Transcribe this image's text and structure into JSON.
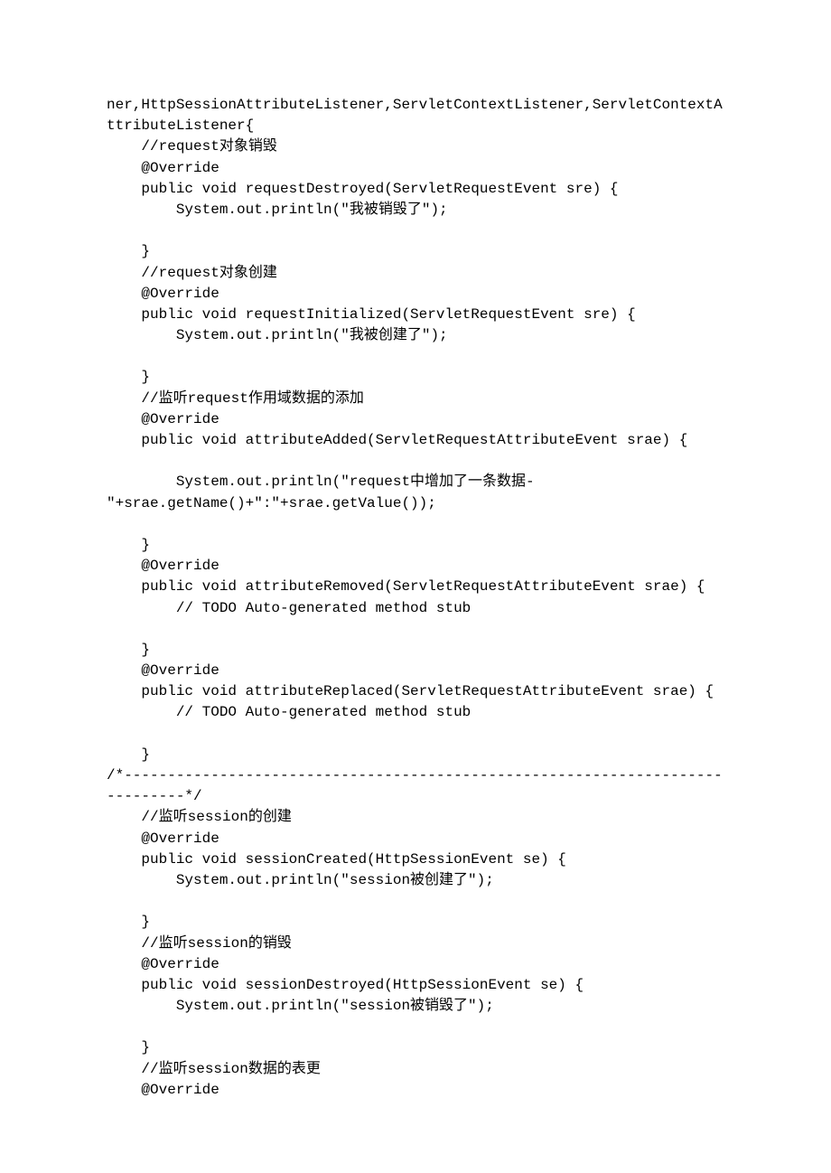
{
  "code": {
    "lines": [
      "ner,HttpSessionAttributeListener,ServletContextListener,ServletContextAttributeListener{",
      "    //request对象销毁",
      "    @Override",
      "    public void requestDestroyed(ServletRequestEvent sre) {",
      "        System.out.println(\"我被销毁了\");",
      "",
      "    }",
      "    //request对象创建",
      "    @Override",
      "    public void requestInitialized(ServletRequestEvent sre) {",
      "        System.out.println(\"我被创建了\");",
      "",
      "    }",
      "    //监听request作用域数据的添加",
      "    @Override",
      "    public void attributeAdded(ServletRequestAttributeEvent srae) {",
      "",
      "        System.out.println(\"request中增加了一条数据-\"+srae.getName()+\":\"+srae.getValue());",
      "",
      "    }",
      "    @Override",
      "    public void attributeRemoved(ServletRequestAttributeEvent srae) {",
      "        // TODO Auto-generated method stub",
      "",
      "    }",
      "    @Override",
      "    public void attributeReplaced(ServletRequestAttributeEvent srae) {",
      "        // TODO Auto-generated method stub",
      "",
      "    }",
      "/*------------------------------------------------------------------------------*/",
      "    //监听session的创建",
      "    @Override",
      "    public void sessionCreated(HttpSessionEvent se) {",
      "        System.out.println(\"session被创建了\");",
      "",
      "    }",
      "    //监听session的销毁",
      "    @Override",
      "    public void sessionDestroyed(HttpSessionEvent se) {",
      "        System.out.println(\"session被销毁了\");",
      "",
      "    }",
      "    //监听session数据的表更",
      "    @Override"
    ]
  }
}
